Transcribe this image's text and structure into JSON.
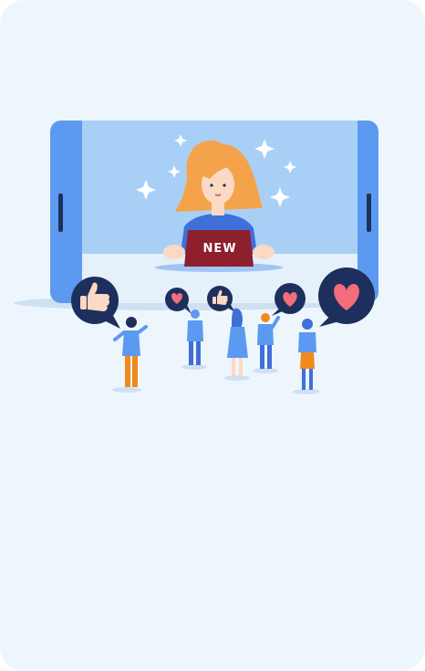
{
  "card": {
    "background": "#eef6fd"
  },
  "illustration": {
    "laptop_label": "NEW",
    "icons": [
      "thumbs-up-icon",
      "heart-icon",
      "thumbs-up-icon",
      "heart-icon",
      "heart-icon"
    ],
    "colors": {
      "phone_frame": "#5b9af0",
      "phone_screen": "#a8d0f7",
      "bubble": "#1d2f5c",
      "heart": "#f26d7d",
      "hair": "#f5a34a",
      "laptop": "#8e1f2c"
    }
  }
}
